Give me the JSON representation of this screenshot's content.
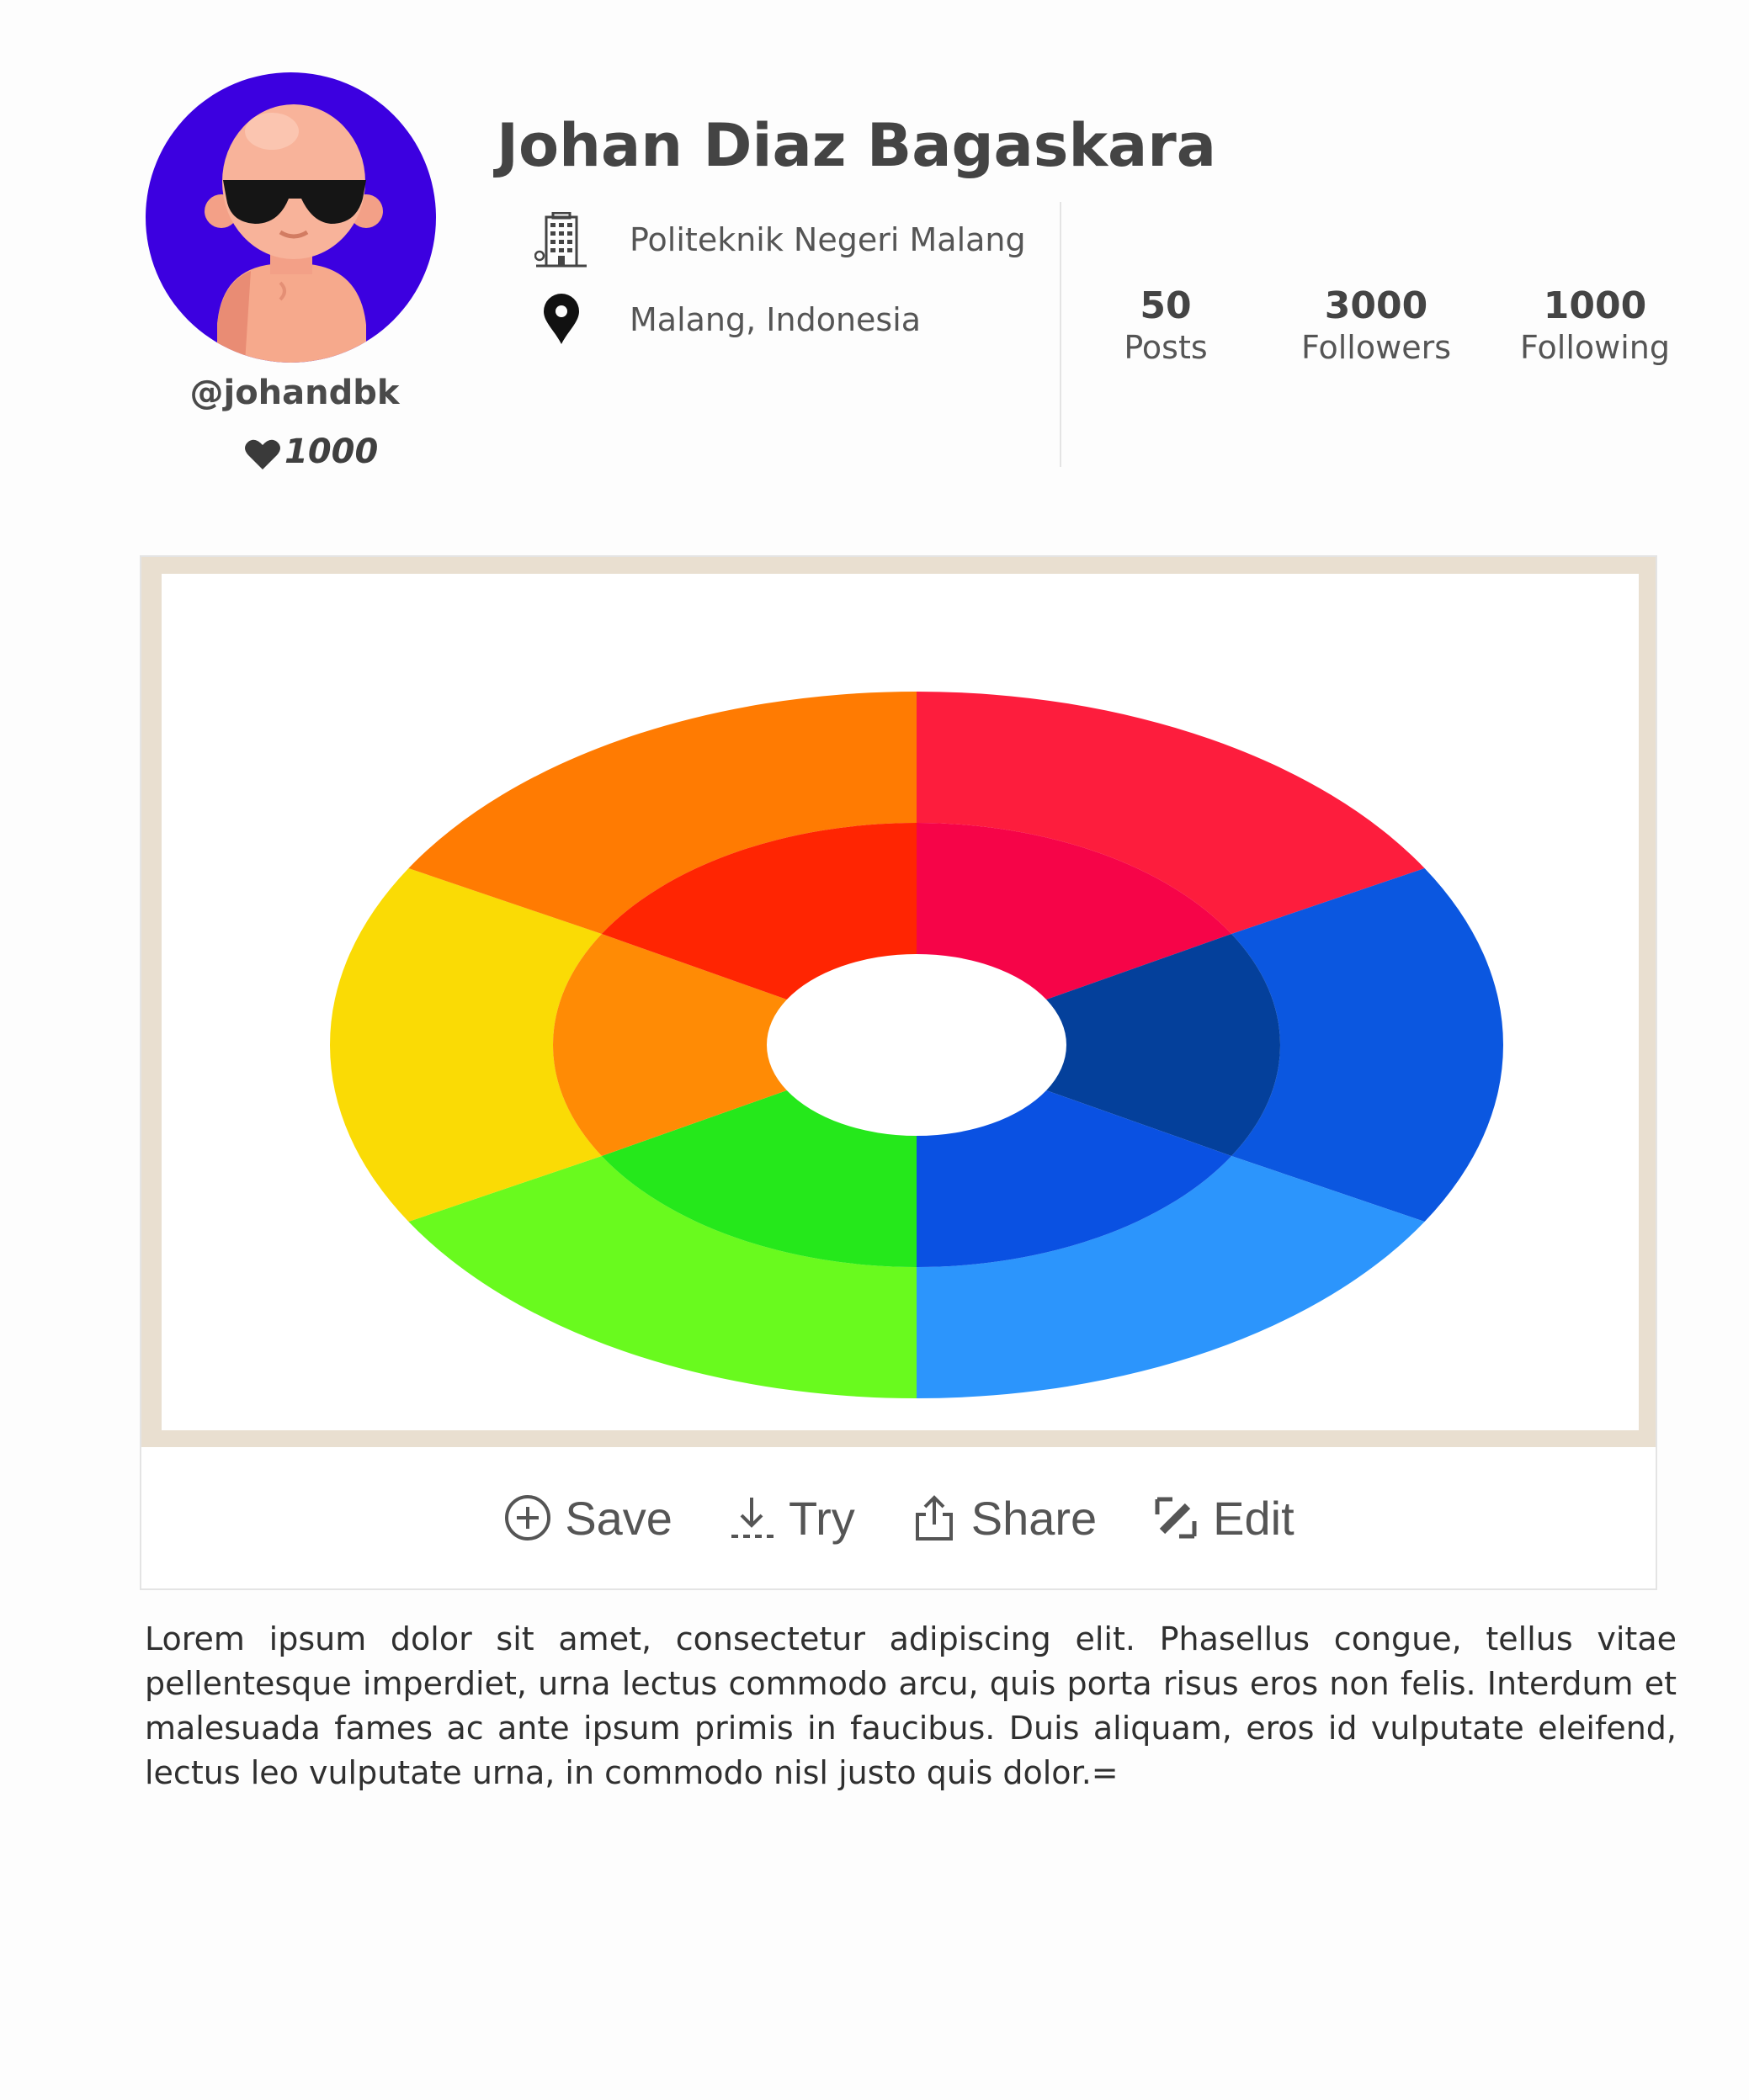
{
  "profile": {
    "name": "Johan Diaz Bagaskara",
    "username": "@johandbk",
    "likes": "1000",
    "institution": "Politeknik Negeri Malang",
    "location": "Malang, Indonesia",
    "avatar_bg": "#3c00e0",
    "stats": {
      "posts": {
        "value": "50",
        "label": "Posts"
      },
      "followers": {
        "value": "3000",
        "label": "Followers"
      },
      "following": {
        "value": "1000",
        "label": "Following"
      }
    }
  },
  "post": {
    "frame_color": "#e9dfd0",
    "actions": {
      "save": "Save",
      "try": "Try",
      "share": "Share",
      "edit": "Edit"
    },
    "description": "Lorem ipsum dolor sit amet, consectetur adipiscing elit. Phasellus congue, tellus vitae pellentesque imperdiet, urna lectus commodo arcu, quis porta risus eros non felis. Interdum et malesuada fames ac ante ipsum primis in faucibus. Duis aliquam, eros id vulputate eleifend, lectus leo vulputate urna, in commodo nisl justo quis dolor.="
  },
  "icons": {
    "institution": "building-icon",
    "location": "map-pin-icon",
    "likes": "heart-icon",
    "save": "plus-circle-icon",
    "try": "download-icon",
    "share": "share-icon",
    "edit": "edit-icon"
  },
  "color_wheel": {
    "outer_colors": [
      "#fd1d3d",
      "#0b57e0",
      "#2c95fc",
      "#69fa1e",
      "#fadb05",
      "#ff7b02"
    ],
    "inner_colors": [
      "#f60448",
      "#04409b",
      "#0a51e2",
      "#25e81b",
      "#ff8b05",
      "#ff2502"
    ]
  }
}
